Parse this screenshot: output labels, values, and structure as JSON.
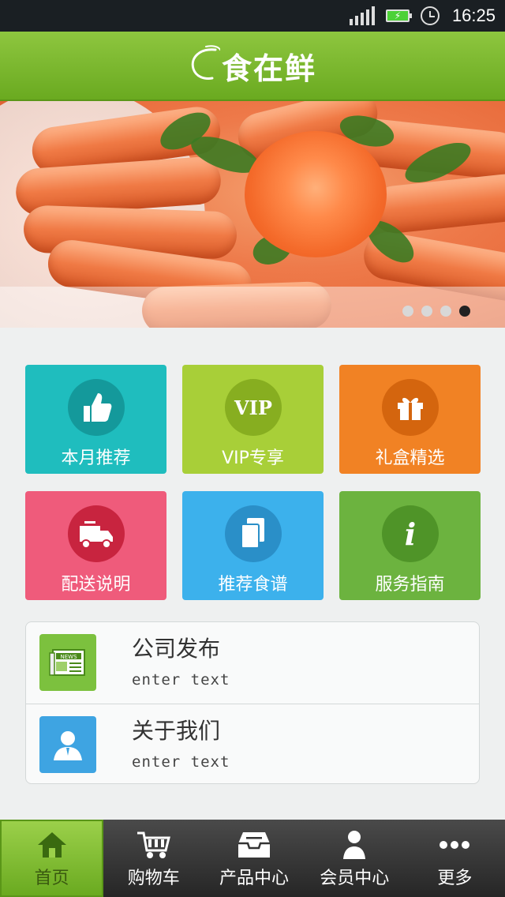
{
  "status_bar": {
    "time": "16:25"
  },
  "header": {
    "logo_text": "食在鲜"
  },
  "banner": {
    "slide_count": 4,
    "active_index": 3
  },
  "grid": {
    "tiles": [
      {
        "label": "本月推荐",
        "icon": "thumbs-up-icon",
        "bg": "#1fbdbe",
        "circle": "#14999b"
      },
      {
        "label": "VIP专享",
        "icon": "vip-icon",
        "icon_text": "VIP",
        "bg": "#a8cf38",
        "circle": "#87ae20"
      },
      {
        "label": "礼盒精选",
        "icon": "gift-box-icon",
        "bg": "#f18224",
        "circle": "#d4650e"
      },
      {
        "label": "配送说明",
        "icon": "delivery-truck-icon",
        "bg": "#ef5b7b",
        "circle": "#c8243f"
      },
      {
        "label": "推荐食谱",
        "icon": "documents-icon",
        "bg": "#3cb1ec",
        "circle": "#2a8fc8"
      },
      {
        "label": "服务指南",
        "icon": "info-icon",
        "icon_text": "i",
        "bg": "#6cb33f",
        "circle": "#4f9428"
      }
    ]
  },
  "info_list": [
    {
      "title": "公司发布",
      "subtitle": "enter text",
      "icon": "news-icon",
      "icon_bg": "#7cc13e",
      "badge_text": "NEWS"
    },
    {
      "title": "关于我们",
      "subtitle": "enter text",
      "icon": "person-icon",
      "icon_bg": "#3ea4e2"
    }
  ],
  "tab_bar": {
    "tabs": [
      {
        "label": "首页",
        "icon": "home-icon",
        "active": true
      },
      {
        "label": "购物车",
        "icon": "shopping-cart-icon",
        "active": false
      },
      {
        "label": "产品中心",
        "icon": "inbox-icon",
        "active": false
      },
      {
        "label": "会员中心",
        "icon": "member-icon",
        "active": false
      },
      {
        "label": "更多",
        "icon": "more-icon",
        "active": false
      }
    ]
  }
}
